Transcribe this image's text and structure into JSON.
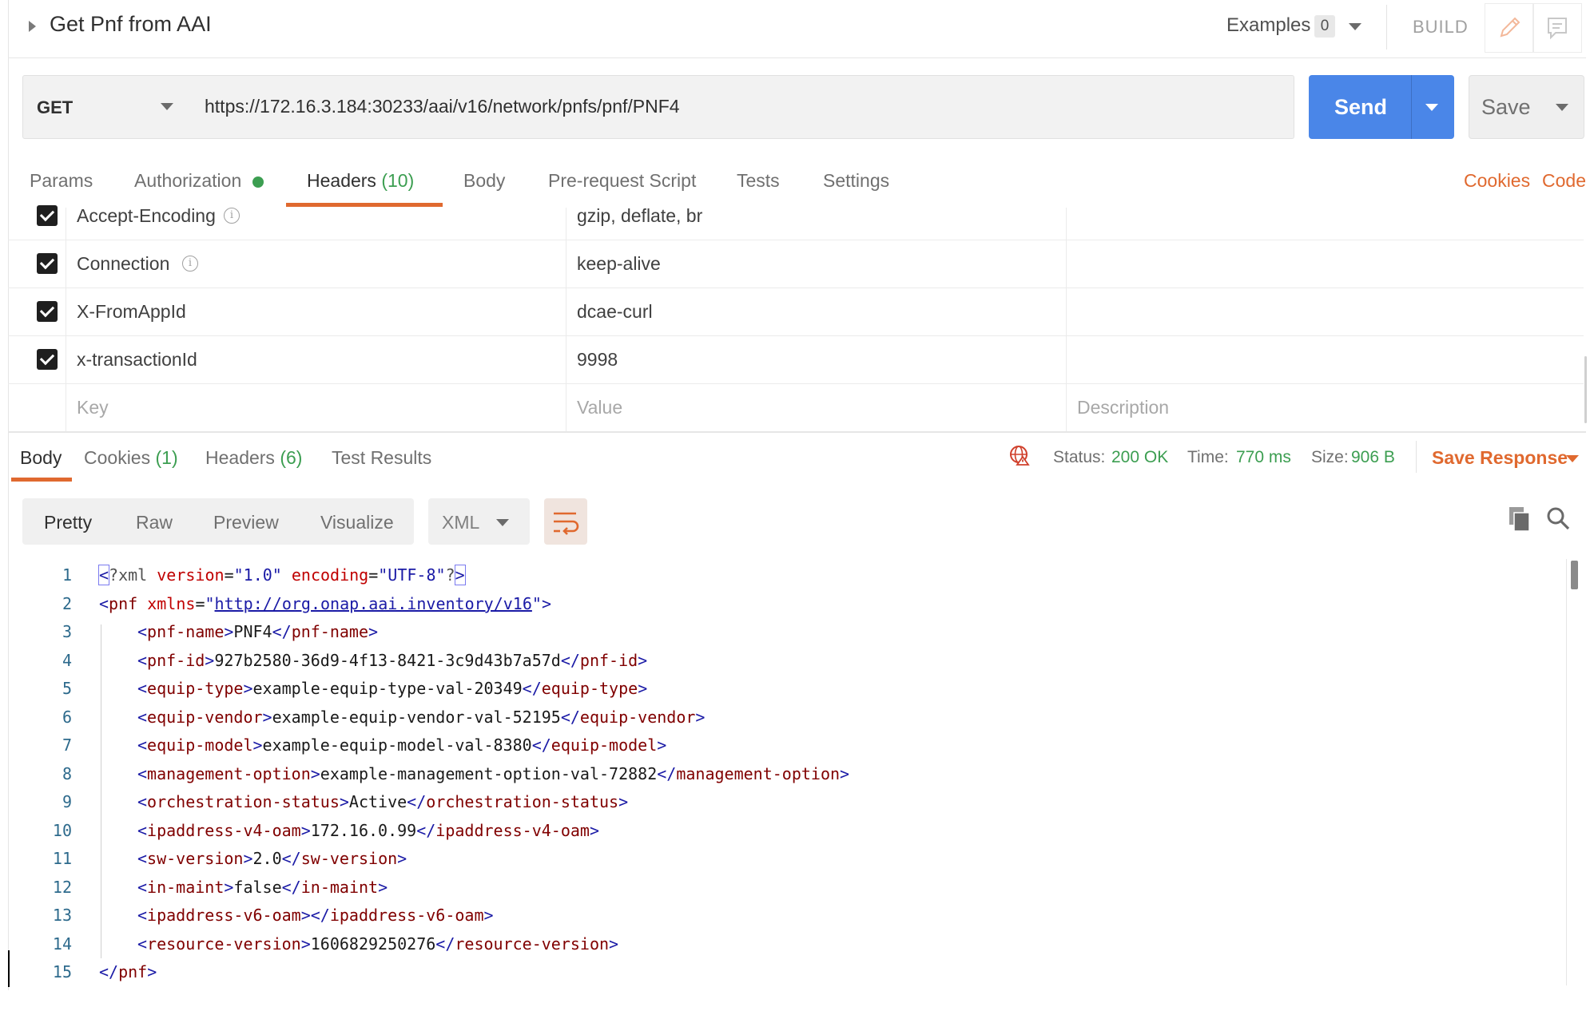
{
  "request": {
    "title": "Get Pnf from AAI",
    "examples_label": "Examples",
    "examples_count": "0",
    "build_label": "BUILD",
    "method": "GET",
    "url": "https://172.16.3.184:30233/aai/v16/network/pnfs/pnf/PNF4",
    "send_label": "Send",
    "save_label": "Save"
  },
  "request_tabs": {
    "params": "Params",
    "authorization": "Authorization",
    "headers": "Headers",
    "headers_count": "(10)",
    "body": "Body",
    "pre_request": "Pre-request Script",
    "tests": "Tests",
    "settings": "Settings",
    "cookies_link": "Cookies",
    "code_link": "Code"
  },
  "headers_table": {
    "rows": [
      {
        "key": "Accept-Encoding",
        "value": "gzip, deflate, br",
        "checked": true,
        "info": true
      },
      {
        "key": "Connection",
        "value": "keep-alive",
        "checked": true,
        "info": true
      },
      {
        "key": "X-FromAppId",
        "value": "dcae-curl",
        "checked": true,
        "info": false
      },
      {
        "key": "x-transactionId",
        "value": "9998",
        "checked": true,
        "info": false
      }
    ],
    "placeholders": {
      "key": "Key",
      "value": "Value",
      "description": "Description"
    }
  },
  "response": {
    "tabs": {
      "body": "Body",
      "cookies": "Cookies",
      "cookies_count": "(1)",
      "headers": "Headers",
      "headers_count": "(6)",
      "test_results": "Test Results"
    },
    "status_label": "Status:",
    "status_value": "200 OK",
    "time_label": "Time:",
    "time_value": "770 ms",
    "size_label": "Size:",
    "size_value": "906 B",
    "save_response": "Save Response",
    "view_options": [
      "Pretty",
      "Raw",
      "Preview",
      "Visualize"
    ],
    "format": "XML"
  },
  "code": {
    "line_numbers": [
      "1",
      "2",
      "3",
      "4",
      "5",
      "6",
      "7",
      "8",
      "9",
      "10",
      "11",
      "12",
      "13",
      "14",
      "15"
    ],
    "xml_decl": {
      "open": "<",
      "name": "?xml",
      "attr1": "version",
      "val1": "\"1.0\"",
      "attr2": "encoding",
      "val2": "\"UTF-8\"",
      "close_q": "?",
      "close": ">"
    },
    "root": {
      "name": "pnf",
      "attr": "xmlns",
      "ns": "http://org.onap.aai.inventory/v16"
    },
    "elements": [
      {
        "name": "pnf-name",
        "value": "PNF4"
      },
      {
        "name": "pnf-id",
        "value": "927b2580-36d9-4f13-8421-3c9d43b7a57d"
      },
      {
        "name": "equip-type",
        "value": "example-equip-type-val-20349"
      },
      {
        "name": "equip-vendor",
        "value": "example-equip-vendor-val-52195"
      },
      {
        "name": "equip-model",
        "value": "example-equip-model-val-8380"
      },
      {
        "name": "management-option",
        "value": "example-management-option-val-72882"
      },
      {
        "name": "orchestration-status",
        "value": "Active"
      },
      {
        "name": "ipaddress-v4-oam",
        "value": "172.16.0.99"
      },
      {
        "name": "sw-version",
        "value": "2.0"
      },
      {
        "name": "in-maint",
        "value": "false"
      },
      {
        "name": "ipaddress-v6-oam",
        "value": ""
      },
      {
        "name": "resource-version",
        "value": "1606829250276"
      }
    ]
  },
  "colors": {
    "accent_orange": "#e0692f",
    "send_blue": "#4a86e8",
    "success_green": "#3c9e51"
  },
  "icons": [
    "edit-icon",
    "comment-icon",
    "info-icon",
    "globe-warning-icon",
    "wrap-lines-icon",
    "copy-icon",
    "search-icon"
  ]
}
